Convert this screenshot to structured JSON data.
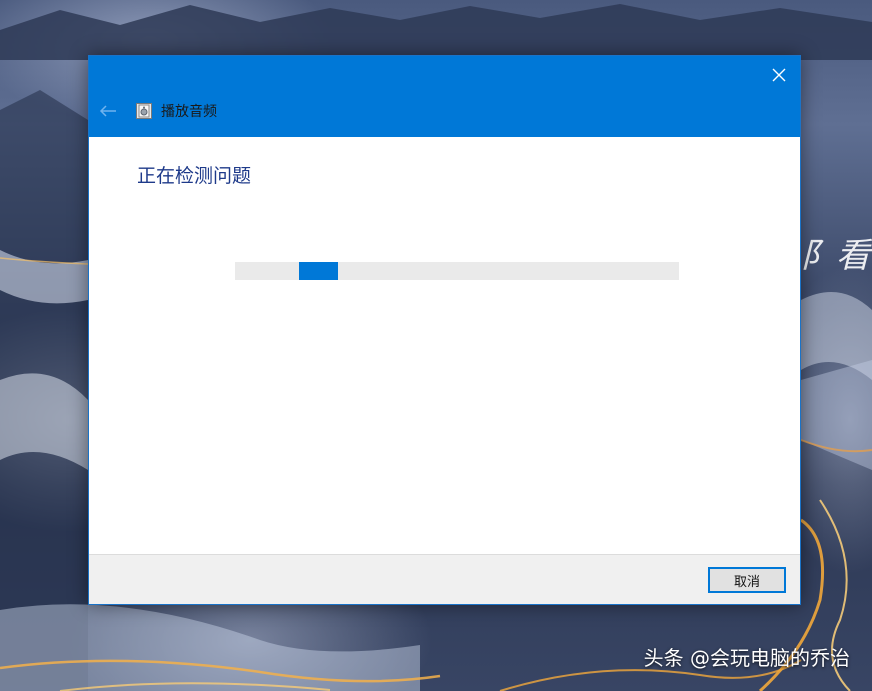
{
  "dialog": {
    "app_title": "播放音频",
    "heading": "正在检测问题",
    "cancel_label": "取消",
    "close_icon": "close-icon",
    "back_icon": "back-arrow-icon",
    "app_icon": "speaker-icon",
    "progress_state": "indeterminate"
  },
  "wallpaper": {
    "handwriting_text": "阝看风",
    "watermark": "头条 @会玩电脑的乔治"
  },
  "colors": {
    "accent": "#0078d7",
    "heading": "#1e3a8a",
    "footer": "#f0f0f0",
    "progress_track": "#eaeaea"
  }
}
